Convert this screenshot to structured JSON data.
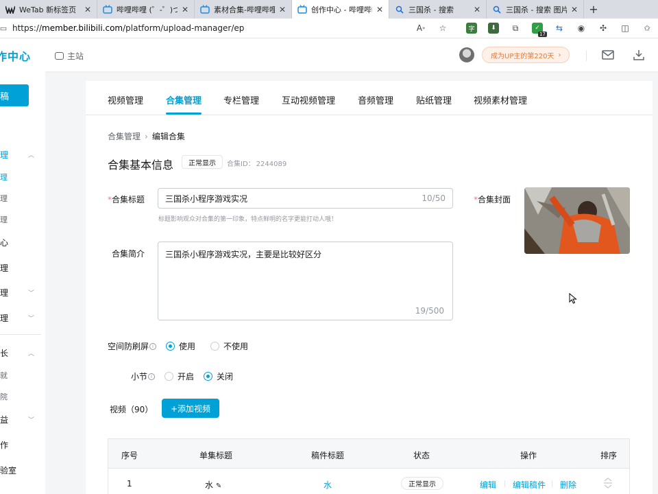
{
  "browser": {
    "tabs": [
      {
        "title": "WeTab 新标签页",
        "icon": "wetab-icon",
        "active": false
      },
      {
        "title": "哔哩哔哩 (゜-゜)つロ 干杯~",
        "icon": "bilibili-tv-icon",
        "active": false
      },
      {
        "title": "素材合集-哔哩哔哩_Bilibili",
        "icon": "bilibili-tv-icon",
        "active": false
      },
      {
        "title": "创作中心 - 哔哩哔哩弹幕视频网",
        "icon": "bilibili-tv-icon",
        "active": true
      },
      {
        "title": "三国杀 - 搜索",
        "icon": "search-icon",
        "active": false
      },
      {
        "title": "三国杀 - 搜索 图片",
        "icon": "search-icon",
        "active": false
      }
    ],
    "url_prefix": "https://",
    "url_host": "member.bilibili.com",
    "url_path": "/platform/upload-manager/ep",
    "ext_badge": "17"
  },
  "header": {
    "brand": "作中心",
    "main_site": "主站",
    "up_badge": "成为UP主的第220天",
    "up_badge_arrow": "›"
  },
  "sidebar": {
    "contribute": "稿",
    "items": [
      {
        "label": "理",
        "chevron": "⌃"
      },
      {
        "label": "理"
      },
      {
        "label": "理"
      },
      {
        "label": "理"
      },
      {
        "label": "心"
      },
      {
        "label": "理"
      },
      {
        "label": "理",
        "chevron": "⌄"
      },
      {
        "label": "理",
        "chevron": "⌄"
      },
      {
        "label": "长",
        "chevron": "⌃"
      },
      {
        "label": "就"
      },
      {
        "label": "院"
      },
      {
        "label": "益",
        "chevron": "⌄"
      },
      {
        "label": "作"
      },
      {
        "label": "验室"
      }
    ]
  },
  "nav_tabs": [
    "视频管理",
    "合集管理",
    "专栏管理",
    "互动视频管理",
    "音频管理",
    "贴纸管理",
    "视频素材管理"
  ],
  "breadcrumb": {
    "parent": "合集管理",
    "sep": "›",
    "current": "编辑合集"
  },
  "section": {
    "title": "合集基本信息",
    "status": "正常显示",
    "id_label": "合集ID：",
    "id_value": "2244089"
  },
  "form": {
    "title_label": "合集标题",
    "title_value": "三国杀小程序游戏实况",
    "title_count": "10/50",
    "title_hint": "标题影响观众对合集的第一印象，特点鲜明的名字更能打动人哦！",
    "desc_label": "合集简介",
    "desc_value": "三国杀小程序游戏实况，主要是比较好区分",
    "desc_count": "19/500",
    "cover_label": "合集封面",
    "anti_label": "空间防刷屏",
    "anti_on": "使用",
    "anti_off": "不使用",
    "anti_selected": "使用",
    "section_label": "小节",
    "section_on": "开启",
    "section_off": "关闭",
    "section_selected": "关闭",
    "videos_label": "视频（90）",
    "add_video": "+添加视频"
  },
  "table": {
    "headers": [
      "序号",
      "单集标题",
      "稿件标题",
      "状态",
      "操作",
      "排序"
    ],
    "rows": [
      {
        "no": "1",
        "ep_title": "水",
        "post_title": "水",
        "status": "正常显示",
        "edit": "编辑",
        "edit_post": "编辑稿件",
        "delete": "删除"
      }
    ]
  },
  "colors": {
    "accent": "#00a1d6",
    "pink": "#fb7299",
    "badge_orange": "#e07a3c"
  }
}
